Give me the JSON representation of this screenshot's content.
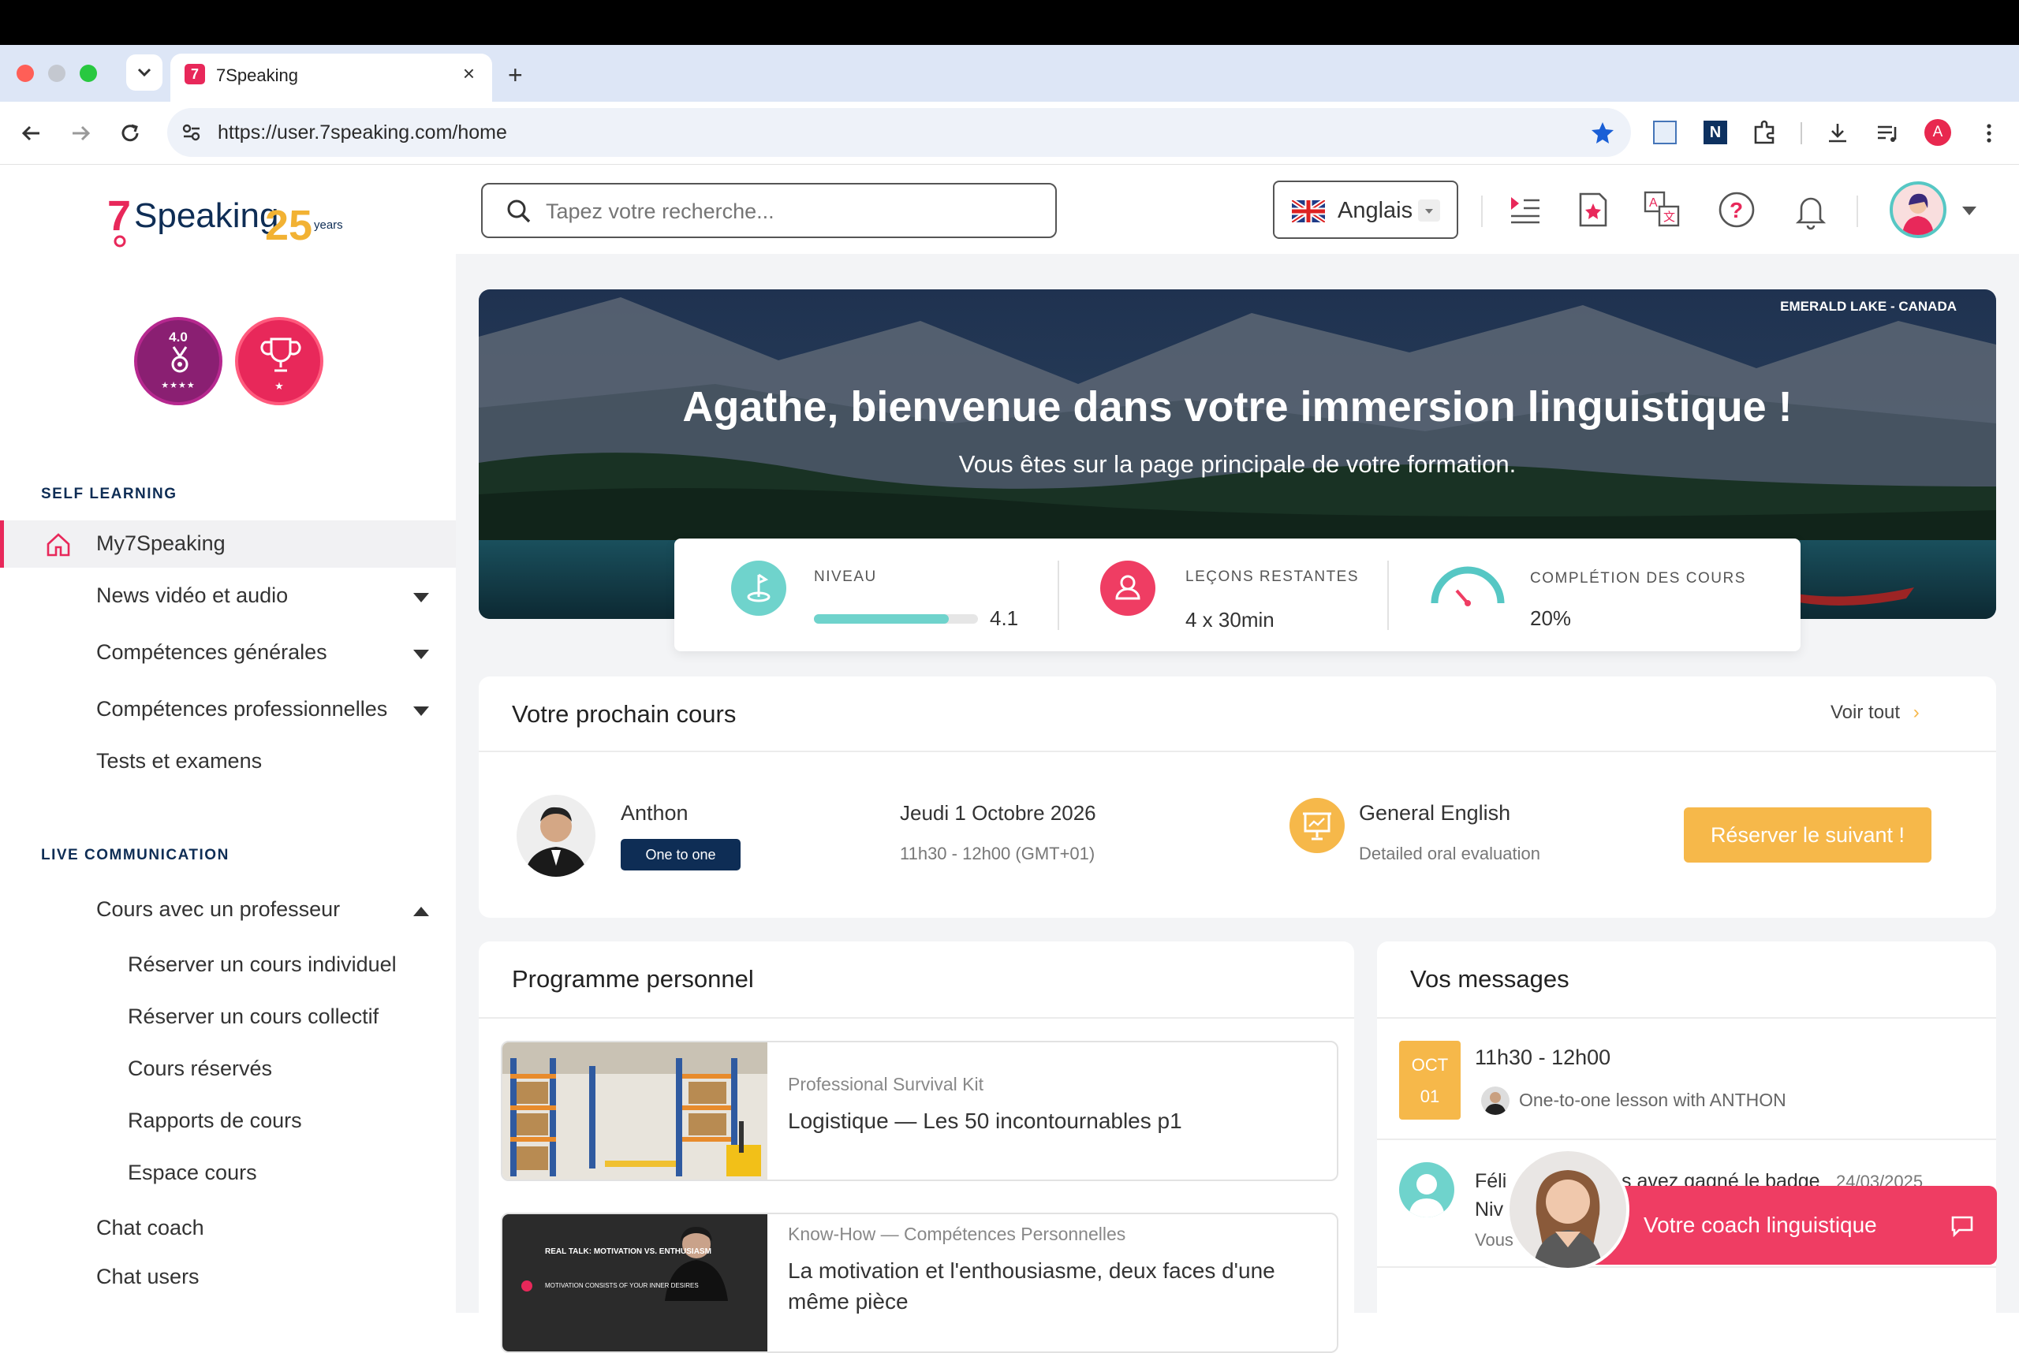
{
  "browser": {
    "tab_title": "7Speaking",
    "url": "https://user.7speaking.com/home"
  },
  "header": {
    "search_placeholder": "Tapez votre recherche...",
    "language": "Anglais",
    "avatar_initial": "A"
  },
  "sidebar": {
    "badge_level": "4.0",
    "section_self": "SELF LEARNING",
    "section_live": "LIVE COMMUNICATION",
    "items": [
      "My7Speaking",
      "News vidéo et audio",
      "Compétences générales",
      "Compétences professionnelles",
      "Tests et examens",
      "Cours avec un professeur",
      "Réserver un cours individuel",
      "Réserver un cours collectif",
      "Cours réservés",
      "Rapports de cours",
      "Espace cours",
      "Chat coach",
      "Chat users"
    ]
  },
  "hero": {
    "location": "EMERALD LAKE - CANADA",
    "title": "Agathe, bienvenue dans votre immersion linguistique !",
    "subtitle": "Vous êtes sur la page principale de votre formation."
  },
  "stats": {
    "level_label": "NIVEAU",
    "level_value": "4.1",
    "level_fraction": 0.82,
    "lessons_label": "LEÇONS RESTANTES",
    "lessons_value": "4 x 30min",
    "completion_label": "COMPLÉTION DES COURS",
    "completion_value": "20%"
  },
  "next_course": {
    "title": "Votre prochain cours",
    "see_all": "Voir tout",
    "teacher": "Anthon",
    "type_badge": "One to one",
    "date": "Jeudi 1 Octobre 2026",
    "time": "11h30 - 12h00 (GMT+01)",
    "course_name": "General English",
    "course_desc": "Detailed oral evaluation",
    "book_button": "Réserver le suivant !"
  },
  "program": {
    "title": "Programme personnel",
    "items": [
      {
        "category": "Professional Survival Kit",
        "title": "Logistique — Les 50 incontournables p1"
      },
      {
        "category": "Know-How — Compétences Personnelles",
        "title": "La motivation et l'enthousiasme, deux faces d'une même pièce",
        "thumb_line1": "REAL TALK: MOTIVATION VS. ENTHUSIASM",
        "thumb_line2": "MOTIVATION CONSISTS OF YOUR INNER DESIRES"
      }
    ]
  },
  "messages": {
    "title": "Vos messages",
    "items": [
      {
        "month": "OCT",
        "day": "01",
        "time": "11h30 - 12h00",
        "text": "One-to-one lesson with ANTHON"
      },
      {
        "line1_a": "Féli",
        "line1_b": "s avez gagné le badge",
        "date": "24/03/2025",
        "line2": "Niv",
        "line3": "Vous"
      }
    ]
  },
  "coach_widget": {
    "label": "Votre coach linguistique"
  },
  "colors": {
    "brand_pink": "#ef3d63",
    "navy": "#0e2d55",
    "teal": "#56c7c4",
    "orange": "#f6b84a"
  }
}
